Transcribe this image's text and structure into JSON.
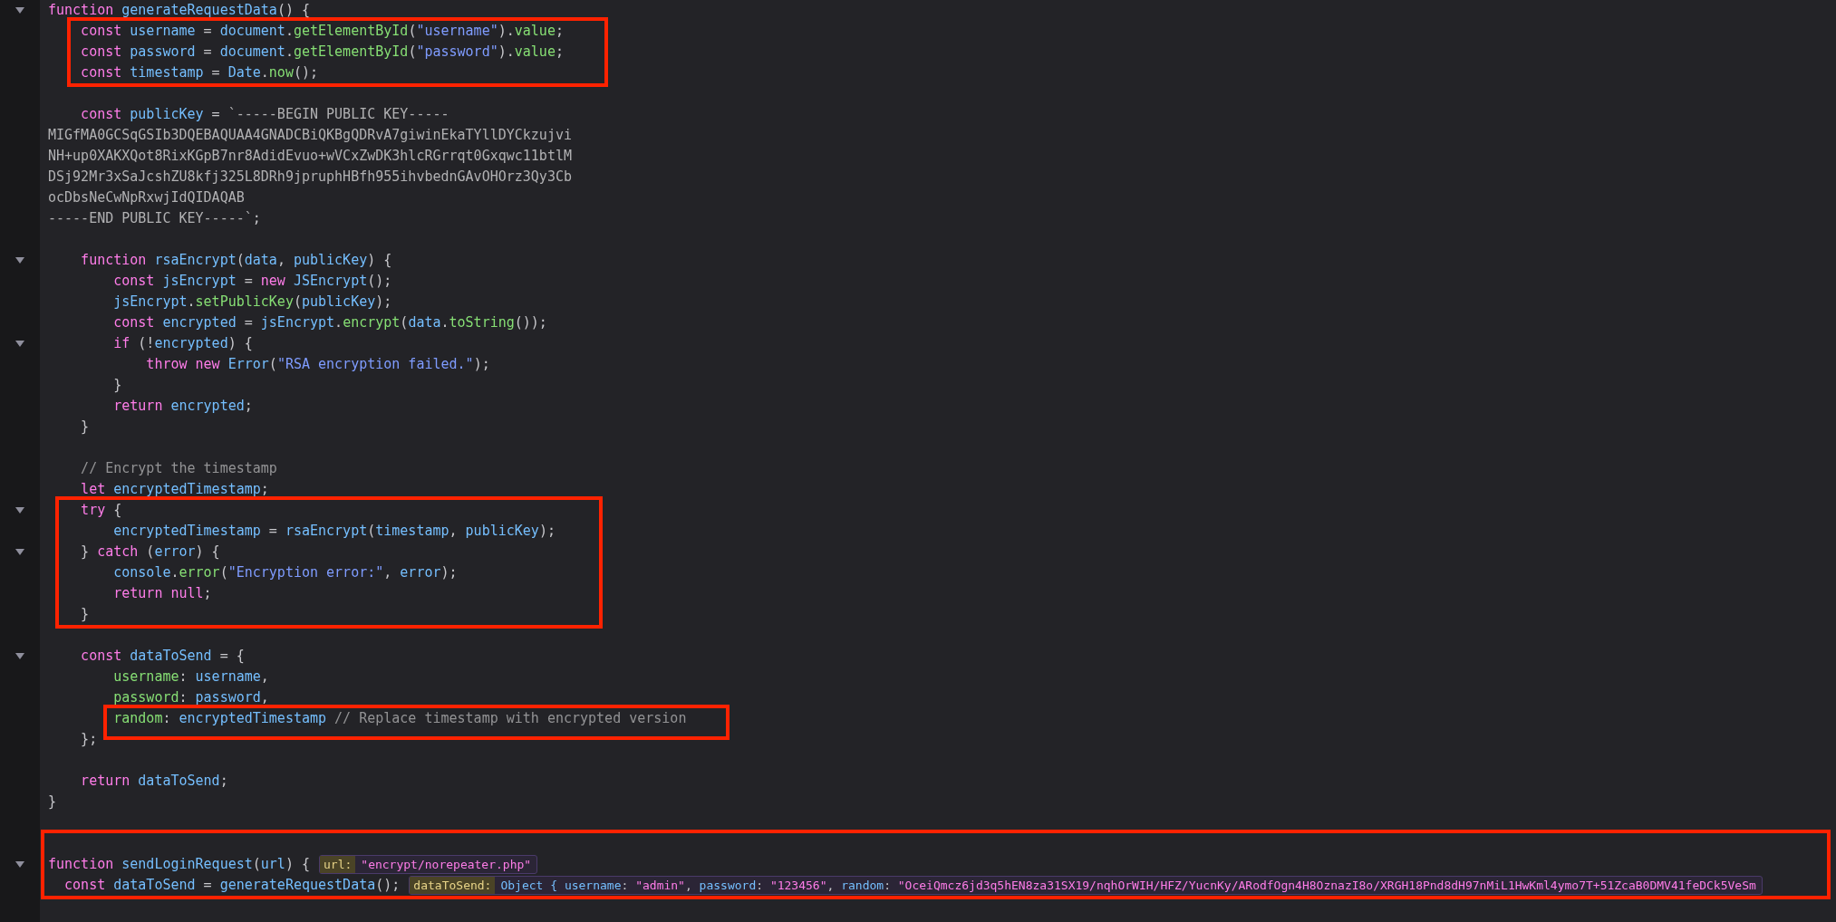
{
  "code": [
    {
      "boxed": false,
      "lines": [
        {
          "kind": "code",
          "expanded": true,
          "tokens": [
            {
              "kind": "k",
              "text": "function "
            },
            {
              "kind": "v",
              "text": "generateRequestData"
            },
            {
              "kind": "p",
              "text": "() {"
            }
          ]
        }
      ]
    },
    {
      "boxed": true,
      "lines": [
        {
          "kind": "code",
          "tokens": [
            {
              "kind": "k",
              "text": "    const "
            },
            {
              "kind": "v",
              "text": "username"
            },
            {
              "kind": "p",
              "text": " = "
            },
            {
              "kind": "v",
              "text": "document"
            },
            {
              "kind": "p",
              "text": "."
            },
            {
              "kind": "m",
              "text": "getElementById"
            },
            {
              "kind": "p",
              "text": "("
            },
            {
              "kind": "s",
              "text": "\"username\""
            },
            {
              "kind": "p",
              "text": ")."
            },
            {
              "kind": "m",
              "text": "value"
            },
            {
              "kind": "p",
              "text": ";"
            }
          ]
        },
        {
          "kind": "code",
          "tokens": [
            {
              "kind": "k",
              "text": "    const "
            },
            {
              "kind": "v",
              "text": "password"
            },
            {
              "kind": "p",
              "text": " = "
            },
            {
              "kind": "v",
              "text": "document"
            },
            {
              "kind": "p",
              "text": "."
            },
            {
              "kind": "m",
              "text": "getElementById"
            },
            {
              "kind": "p",
              "text": "("
            },
            {
              "kind": "s",
              "text": "\"password\""
            },
            {
              "kind": "p",
              "text": ")."
            },
            {
              "kind": "m",
              "text": "value"
            },
            {
              "kind": "p",
              "text": ";"
            }
          ]
        },
        {
          "kind": "code",
          "tokens": [
            {
              "kind": "k",
              "text": "    const "
            },
            {
              "kind": "v",
              "text": "timestamp"
            },
            {
              "kind": "p",
              "text": " = "
            },
            {
              "kind": "v",
              "text": "Date"
            },
            {
              "kind": "p",
              "text": "."
            },
            {
              "kind": "m",
              "text": "now"
            },
            {
              "kind": "p",
              "text": "();"
            }
          ]
        }
      ]
    },
    {
      "boxed": false,
      "lines": [
        {
          "kind": "blank"
        },
        {
          "kind": "code",
          "tokens": [
            {
              "kind": "k",
              "text": "    const "
            },
            {
              "kind": "v",
              "text": "publicKey"
            },
            {
              "kind": "p",
              "text": " = "
            },
            {
              "kind": "t",
              "text": "`-----BEGIN PUBLIC KEY-----"
            }
          ]
        },
        {
          "kind": "code",
          "tokens": [
            {
              "kind": "t",
              "text": "MIGfMA0GCSqGSIb3DQEBAQUAA4GNADCBiQKBgQDRvA7giwinEkaTYllDYCkzujvi"
            }
          ]
        },
        {
          "kind": "code",
          "tokens": [
            {
              "kind": "t",
              "text": "NH+up0XAKXQot8RixKGpB7nr8AdidEvuo+wVCxZwDK3hlcRGrrqt0Gxqwc11btlM"
            }
          ]
        },
        {
          "kind": "code",
          "tokens": [
            {
              "kind": "t",
              "text": "DSj92Mr3xSaJcshZU8kfj325L8DRh9jpruphHBfh955ihvbednGAvOHOrz3Qy3Cb"
            }
          ]
        },
        {
          "kind": "code",
          "tokens": [
            {
              "kind": "t",
              "text": "ocDbsNeCwNpRxwjIdQIDAQAB"
            }
          ]
        },
        {
          "kind": "code",
          "tokens": [
            {
              "kind": "t",
              "text": "-----END PUBLIC KEY-----`"
            },
            {
              "kind": "p",
              "text": ";"
            }
          ]
        },
        {
          "kind": "blank"
        },
        {
          "kind": "code",
          "expanded": true,
          "tokens": [
            {
              "kind": "k",
              "text": "    function "
            },
            {
              "kind": "v",
              "text": "rsaEncrypt"
            },
            {
              "kind": "p",
              "text": "("
            },
            {
              "kind": "v",
              "text": "data"
            },
            {
              "kind": "p",
              "text": ", "
            },
            {
              "kind": "v",
              "text": "publicKey"
            },
            {
              "kind": "p",
              "text": ") {"
            }
          ]
        },
        {
          "kind": "code",
          "tokens": [
            {
              "kind": "k",
              "text": "        const "
            },
            {
              "kind": "v",
              "text": "jsEncrypt"
            },
            {
              "kind": "p",
              "text": " = "
            },
            {
              "kind": "k",
              "text": "new "
            },
            {
              "kind": "v",
              "text": "JSEncrypt"
            },
            {
              "kind": "p",
              "text": "();"
            }
          ]
        },
        {
          "kind": "code",
          "tokens": [
            {
              "kind": "v",
              "text": "        jsEncrypt"
            },
            {
              "kind": "p",
              "text": "."
            },
            {
              "kind": "m",
              "text": "setPublicKey"
            },
            {
              "kind": "p",
              "text": "("
            },
            {
              "kind": "v",
              "text": "publicKey"
            },
            {
              "kind": "p",
              "text": ");"
            }
          ]
        },
        {
          "kind": "code",
          "tokens": [
            {
              "kind": "k",
              "text": "        const "
            },
            {
              "kind": "v",
              "text": "encrypted"
            },
            {
              "kind": "p",
              "text": " = "
            },
            {
              "kind": "v",
              "text": "jsEncrypt"
            },
            {
              "kind": "p",
              "text": "."
            },
            {
              "kind": "m",
              "text": "encrypt"
            },
            {
              "kind": "p",
              "text": "("
            },
            {
              "kind": "v",
              "text": "data"
            },
            {
              "kind": "p",
              "text": "."
            },
            {
              "kind": "m",
              "text": "toString"
            },
            {
              "kind": "p",
              "text": "());"
            }
          ]
        },
        {
          "kind": "code",
          "expanded": true,
          "tokens": [
            {
              "kind": "k",
              "text": "        if"
            },
            {
              "kind": "p",
              "text": " (!"
            },
            {
              "kind": "v",
              "text": "encrypted"
            },
            {
              "kind": "p",
              "text": ") {"
            }
          ]
        },
        {
          "kind": "code",
          "tokens": [
            {
              "kind": "k",
              "text": "            throw new "
            },
            {
              "kind": "v",
              "text": "Error"
            },
            {
              "kind": "p",
              "text": "("
            },
            {
              "kind": "s",
              "text": "\"RSA encryption failed.\""
            },
            {
              "kind": "p",
              "text": ");"
            }
          ]
        },
        {
          "kind": "code",
          "tokens": [
            {
              "kind": "p",
              "text": "        }"
            }
          ]
        },
        {
          "kind": "code",
          "tokens": [
            {
              "kind": "k",
              "text": "        return "
            },
            {
              "kind": "v",
              "text": "encrypted"
            },
            {
              "kind": "p",
              "text": ";"
            }
          ]
        },
        {
          "kind": "code",
          "tokens": [
            {
              "kind": "p",
              "text": "    }"
            }
          ]
        },
        {
          "kind": "blank"
        },
        {
          "kind": "code",
          "tokens": [
            {
              "kind": "c",
              "text": "    // Encrypt the timestamp"
            }
          ]
        },
        {
          "kind": "code",
          "tokens": [
            {
              "kind": "k",
              "text": "    let "
            },
            {
              "kind": "v",
              "text": "encryptedTimestamp"
            },
            {
              "kind": "p",
              "text": ";"
            }
          ]
        }
      ]
    },
    {
      "boxed": true,
      "lines": [
        {
          "kind": "code",
          "expanded": true,
          "tokens": [
            {
              "kind": "k",
              "text": "    try"
            },
            {
              "kind": "p",
              "text": " {"
            }
          ]
        },
        {
          "kind": "code",
          "tokens": [
            {
              "kind": "v",
              "text": "        encryptedTimestamp"
            },
            {
              "kind": "p",
              "text": " = "
            },
            {
              "kind": "v",
              "text": "rsaEncrypt"
            },
            {
              "kind": "p",
              "text": "("
            },
            {
              "kind": "v",
              "text": "timestamp"
            },
            {
              "kind": "p",
              "text": ", "
            },
            {
              "kind": "v",
              "text": "publicKey"
            },
            {
              "kind": "p",
              "text": ");"
            }
          ]
        },
        {
          "kind": "code",
          "expanded": true,
          "tokens": [
            {
              "kind": "p",
              "text": "    } "
            },
            {
              "kind": "k",
              "text": "catch"
            },
            {
              "kind": "p",
              "text": " ("
            },
            {
              "kind": "v",
              "text": "error"
            },
            {
              "kind": "p",
              "text": ") {"
            }
          ]
        },
        {
          "kind": "code",
          "tokens": [
            {
              "kind": "v",
              "text": "        console"
            },
            {
              "kind": "p",
              "text": "."
            },
            {
              "kind": "m",
              "text": "error"
            },
            {
              "kind": "p",
              "text": "("
            },
            {
              "kind": "s",
              "text": "\"Encryption error:\""
            },
            {
              "kind": "p",
              "text": ", "
            },
            {
              "kind": "v",
              "text": "error"
            },
            {
              "kind": "p",
              "text": ");"
            }
          ]
        },
        {
          "kind": "code",
          "tokens": [
            {
              "kind": "k",
              "text": "        return null"
            },
            {
              "kind": "p",
              "text": ";"
            }
          ]
        },
        {
          "kind": "code",
          "tokens": [
            {
              "kind": "p",
              "text": "    }"
            }
          ]
        }
      ]
    },
    {
      "boxed": false,
      "lines": [
        {
          "kind": "blank"
        },
        {
          "kind": "code",
          "expanded": true,
          "tokens": [
            {
              "kind": "k",
              "text": "    const "
            },
            {
              "kind": "v",
              "text": "dataToSend"
            },
            {
              "kind": "p",
              "text": " = {"
            }
          ]
        },
        {
          "kind": "code",
          "tokens": [
            {
              "kind": "m",
              "text": "        username"
            },
            {
              "kind": "p",
              "text": ": "
            },
            {
              "kind": "v",
              "text": "username"
            },
            {
              "kind": "p",
              "text": ","
            }
          ]
        },
        {
          "kind": "code",
          "tokens": [
            {
              "kind": "m",
              "text": "        password"
            },
            {
              "kind": "p",
              "text": ": "
            },
            {
              "kind": "v",
              "text": "password"
            },
            {
              "kind": "p",
              "text": ","
            }
          ]
        }
      ]
    },
    {
      "boxed": true,
      "lines": [
        {
          "kind": "code",
          "tokens": [
            {
              "kind": "m",
              "text": "        random"
            },
            {
              "kind": "p",
              "text": ": "
            },
            {
              "kind": "v",
              "text": "encryptedTimestamp"
            },
            {
              "kind": "c",
              "text": " // Replace timestamp with encrypted version"
            }
          ]
        }
      ]
    },
    {
      "boxed": false,
      "lines": [
        {
          "kind": "code",
          "tokens": [
            {
              "kind": "p",
              "text": "    };"
            }
          ]
        },
        {
          "kind": "blank"
        },
        {
          "kind": "code",
          "tokens": [
            {
              "kind": "k",
              "text": "    return "
            },
            {
              "kind": "v",
              "text": "dataToSend"
            },
            {
              "kind": "p",
              "text": ";"
            }
          ]
        },
        {
          "kind": "code",
          "tokens": [
            {
              "kind": "p",
              "text": "}"
            }
          ]
        },
        {
          "kind": "blank"
        }
      ]
    },
    {
      "boxed": true,
      "lines": [
        {
          "kind": "blank"
        },
        {
          "kind": "code",
          "expanded": true,
          "tokens": [
            {
              "kind": "k",
              "text": "function "
            },
            {
              "kind": "v",
              "text": "sendLoginRequest"
            },
            {
              "kind": "p",
              "text": "("
            },
            {
              "kind": "v",
              "text": "url"
            },
            {
              "kind": "p",
              "text": ") {"
            }
          ],
          "inline_value": {
            "label": "url:",
            "tokens": [
              {
                "kind": "s2",
                "text": "\"encrypt/norepeater.php\""
              }
            ]
          }
        },
        {
          "kind": "code",
          "tokens": [
            {
              "kind": "k",
              "text": "  const "
            },
            {
              "kind": "v",
              "text": "dataToSend"
            },
            {
              "kind": "p",
              "text": " = "
            },
            {
              "kind": "v",
              "text": "generateRequestData"
            },
            {
              "kind": "p",
              "text": "();"
            }
          ],
          "inline_value": {
            "label": "dataToSend:",
            "tokens": [
              {
                "kind": "v",
                "text": "Object { username"
              },
              {
                "kind": "p",
                "text": ": "
              },
              {
                "kind": "s2",
                "text": "\"admin\""
              },
              {
                "kind": "p",
                "text": ", "
              },
              {
                "kind": "v",
                "text": "password"
              },
              {
                "kind": "p",
                "text": ": "
              },
              {
                "kind": "s2",
                "text": "\"123456\""
              },
              {
                "kind": "p",
                "text": ", "
              },
              {
                "kind": "v",
                "text": "random"
              },
              {
                "kind": "p",
                "text": ": "
              },
              {
                "kind": "s2",
                "text": "\"OceiQmcz6jd3q5hEN8za31SX19/nqhOrWIH/HFZ/YucnKy/ARodfOgn4H8OznazI8o/XRGH18Pnd8dH97nMiL1HwKml4ymo7T+51ZcaB0DMV41feDCk5VeSm"
              }
            ]
          }
        }
      ]
    }
  ]
}
